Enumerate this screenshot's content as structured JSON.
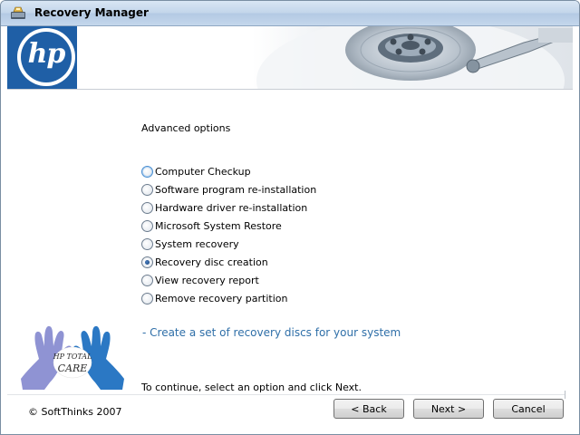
{
  "window": {
    "title": "Recovery Manager"
  },
  "header": {
    "logo_text": "hp"
  },
  "main": {
    "section_label": "Advanced options",
    "options": [
      {
        "label": "Computer Checkup",
        "selected": false,
        "focused": true
      },
      {
        "label": "Software program re-installation",
        "selected": false
      },
      {
        "label": "Hardware driver re-installation",
        "selected": false
      },
      {
        "label": "Microsoft System Restore",
        "selected": false
      },
      {
        "label": "System recovery",
        "selected": false
      },
      {
        "label": "Recovery disc creation",
        "selected": true
      },
      {
        "label": "View recovery report",
        "selected": false
      },
      {
        "label": "Remove recovery partition",
        "selected": false
      }
    ],
    "description": "- Create a set of recovery discs for your system",
    "instruction": "To continue, select an option and click Next."
  },
  "footer": {
    "copyright": "© SoftThinks 2007",
    "back_label": "< Back",
    "next_label": "Next >",
    "cancel_label": "Cancel"
  },
  "logo": {
    "line1": "HP TOTAL",
    "line2": "CARE"
  },
  "colors": {
    "hp_blue": "#1f5fa6",
    "link_blue": "#2f6fa8",
    "hand_left": "#8f93d3",
    "hand_right": "#2b78c4"
  }
}
